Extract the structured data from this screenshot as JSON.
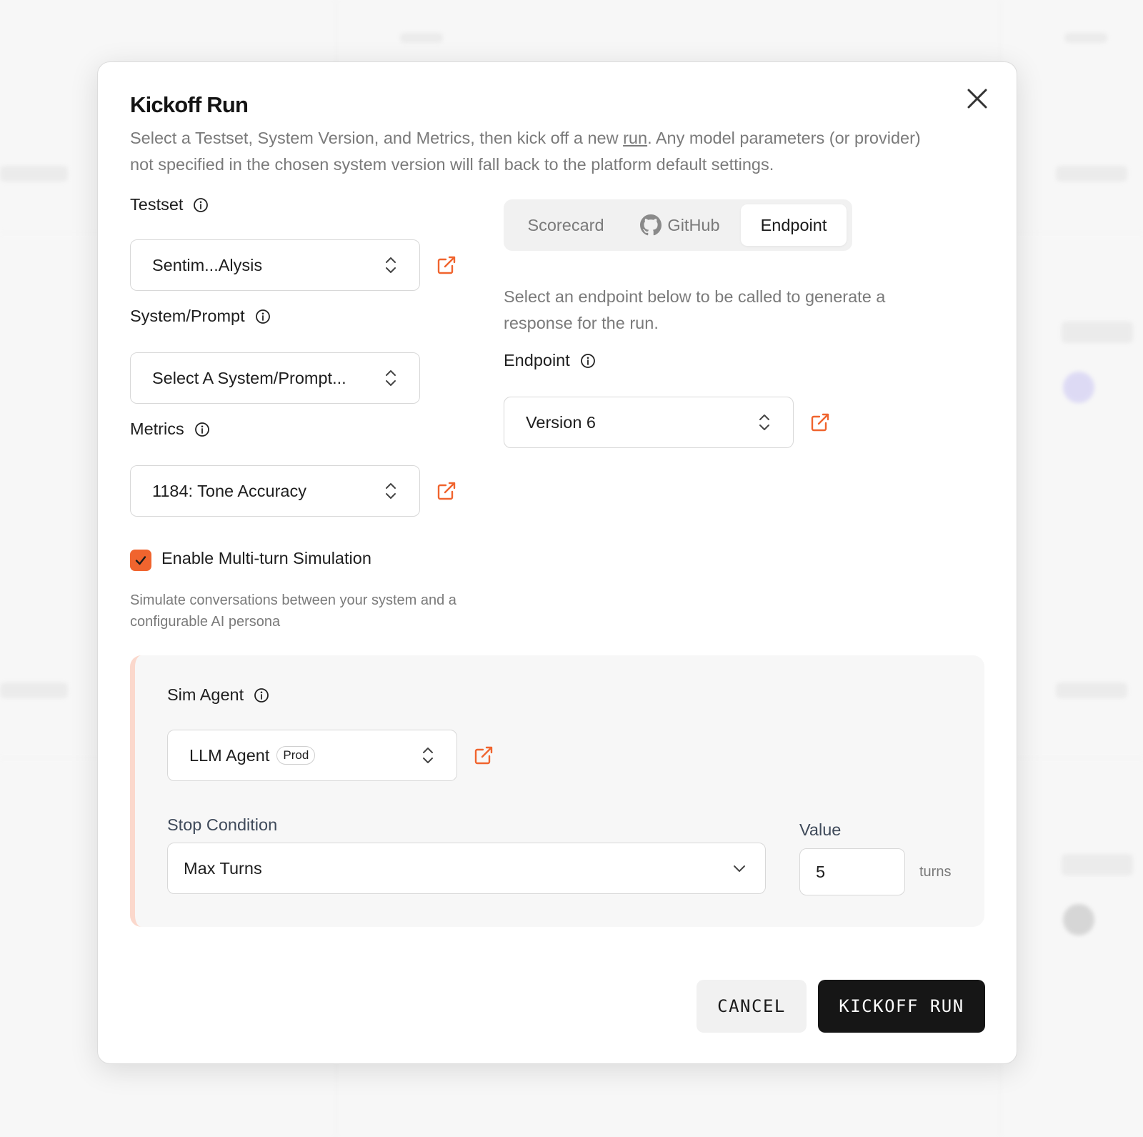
{
  "modal": {
    "title": "Kickoff Run",
    "description_before": "Select a Testset, System Version, and Metrics, then kick off a new ",
    "description_link": "run",
    "description_after": ". Any model parameters (or provider) not specified in the chosen system version will fall back to the platform default settings."
  },
  "testset": {
    "label": "Testset",
    "value": "Sentim...Alysis"
  },
  "system_prompt": {
    "label": "System/Prompt",
    "value": "Select A System/Prompt..."
  },
  "metrics": {
    "label": "Metrics",
    "value": "1184: Tone Accuracy"
  },
  "multi_turn": {
    "checked": true,
    "label": "Enable Multi-turn Simulation",
    "help": "Simulate conversations between your system and a configurable AI persona"
  },
  "tabs": [
    {
      "label": "Scorecard",
      "active": false
    },
    {
      "label": "GitHub",
      "active": false,
      "icon": "github-icon"
    },
    {
      "label": "Endpoint",
      "active": true
    }
  ],
  "endpoint": {
    "description": "Select an endpoint below to be called to generate a response for the run.",
    "label": "Endpoint",
    "value": "Version 6"
  },
  "sim_agent": {
    "label": "Sim Agent",
    "value": "LLM Agent",
    "badge": "Prod"
  },
  "stop_condition": {
    "label": "Stop Condition",
    "value": "Max Turns"
  },
  "value_field": {
    "label": "Value",
    "value": "5",
    "unit": "turns"
  },
  "buttons": {
    "cancel": "CANCEL",
    "kickoff": "KICKOFF RUN"
  },
  "colors": {
    "accent": "#f0642e",
    "primary_button": "#161616",
    "panel_border": "#fbd8cc"
  }
}
